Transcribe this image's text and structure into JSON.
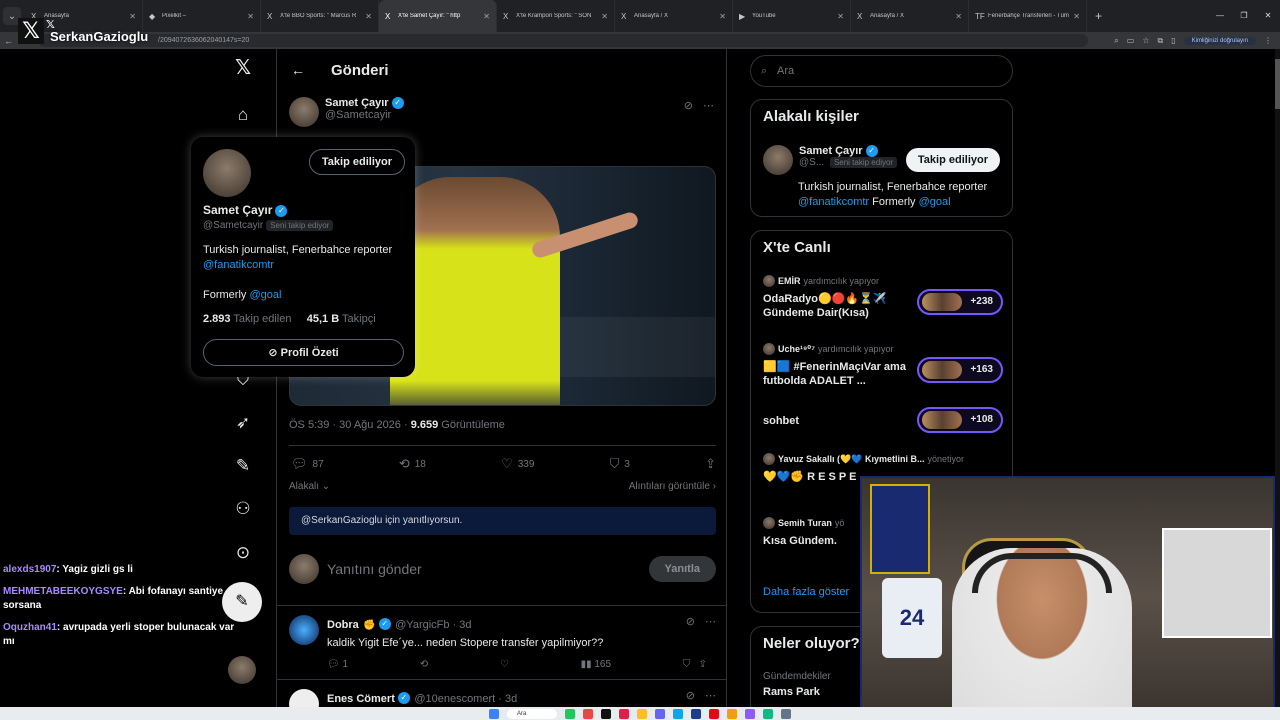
{
  "browser": {
    "tabs": [
      {
        "title": "Anasayfa",
        "icon": "X",
        "active": false
      },
      {
        "title": "Pixelkit –",
        "icon": "◆",
        "active": false
      },
      {
        "title": "X'te BBO Sports: \" Marcus R",
        "icon": "X",
        "active": false
      },
      {
        "title": "X'te Samet Çayır: \" http",
        "icon": "X",
        "active": true
      },
      {
        "title": "X'te Krampon Sports: \" SON",
        "icon": "X",
        "active": false
      },
      {
        "title": "Anasayfa / X",
        "icon": "X",
        "active": false
      },
      {
        "title": "YouTube",
        "icon": "▶",
        "active": false
      },
      {
        "title": "Anasayfa / X",
        "icon": "X",
        "active": false
      },
      {
        "title": "Fenerbahçe Transferleri - Tüm",
        "icon": "TF",
        "active": false
      }
    ],
    "url": "/2094072636062040147s=20",
    "verify_label": "Kimliğinizi doğrulayın"
  },
  "stream": {
    "streamer_name": "SerkanGazioglu",
    "chat": [
      {
        "user": "alexds1907",
        "msg": ": Yagiz gizli gs li",
        "color": "#a78bfa"
      },
      {
        "user": "MEHMETABEEKOYGSYE",
        "msg": ": Abi fofanayı santiye sorsana",
        "color": "#a78bfa"
      },
      {
        "user": "Oquzhan41",
        "msg": ": avrupada yerli stoper bulunacak var mı",
        "color": "#a78bfa"
      }
    ],
    "webcam_jersey": "24"
  },
  "header": {
    "title": "Gönderi"
  },
  "post": {
    "author_name": "Samet Çayır",
    "author_handle": "@Sametcayir",
    "timestamp": "ÖS 5:39 · 30 Ağu 2026 ·",
    "views_count": "9.659",
    "views_label": "Görüntüleme",
    "replies": "87",
    "reposts": "18",
    "likes": "339",
    "bookmarks": "3",
    "relevance_label": "Alakalı",
    "quotes_label": "Alıntıları görüntüle",
    "replying_to": "@SerkanGazioglu için yanıtlıyorsun.",
    "compose_placeholder": "Yanıtını gönder",
    "reply_button": "Yanıtla"
  },
  "hovercard": {
    "follow_label": "Takip ediliyor",
    "name": "Samet Çayır",
    "handle": "@Sametcayir",
    "follows_you": "Seni takip ediyor",
    "bio": "Turkish journalist, Fenerbahce reporter",
    "bio_link": "@fanatikcomtr",
    "formerly": "Formerly",
    "formerly_link": "@goal",
    "following_count": "2.893",
    "following_label": "Takip edilen",
    "followers_count": "45,1 B",
    "followers_label": "Takipçi",
    "profile_summary": "Profil Özeti"
  },
  "replies": [
    {
      "name": "Dobra",
      "handle": "@YargicFb · 3d",
      "text": "kaldik Yigit Efe´ye... neden Stopere transfer yapilmiyor??",
      "replies": "1",
      "views": "165"
    },
    {
      "name": "Enes Cömert",
      "handle": "@10enescomert · 3d",
      "text": "",
      "replies": "",
      "views": ""
    }
  ],
  "right": {
    "search_placeholder": "Ara",
    "related_title": "Alakalı kişiler",
    "related": {
      "name": "Samet Çayır",
      "handle": "@S...",
      "follows_you": "Seni takip ediyor",
      "follow_label": "Takip ediliyor",
      "bio": "Turkish journalist, Fenerbahce reporter",
      "bio_link": "@fanatikcomtr",
      "formerly": "Formerly",
      "formerly_link": "@goal"
    },
    "live_title": "X'te Canlı",
    "live": [
      {
        "host": "EMİR",
        "role": "yardımcılık yapıyor",
        "title": "OdaRadyo🟡🔴🔥⏳✈️ Gündeme Dair(Kısa)",
        "count": "+238"
      },
      {
        "host": "Uche¹⁹⁰⁷",
        "role": "yardımcılık yapıyor",
        "title": "🟨🟦 #FenerinMaçıVar ama futbolda ADALET ...",
        "count": "+163"
      },
      {
        "host": "",
        "role": "",
        "title": "sohbet",
        "count": "+108"
      },
      {
        "host": "Yavuz Sakallı (💛💙 Kıymetlini B...",
        "role": "yönetiyor",
        "title": "💛💙✊ R E S P E",
        "count": ""
      },
      {
        "host": "Semih Turan",
        "role": "yö",
        "title": "Kısa Gündem.",
        "count": ""
      }
    ],
    "more_label": "Daha fazla göster",
    "trending_title": "Neler oluyor?",
    "trend_context": "Gündemdekiler",
    "trend_name": "Rams Park"
  },
  "taskbar": {
    "search": "Ara"
  }
}
